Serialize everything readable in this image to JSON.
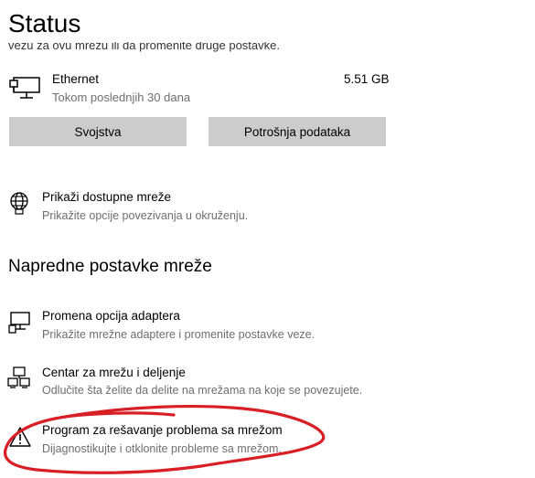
{
  "header": {
    "title": "Status"
  },
  "partial_text": "vezu za ovu mrežu ili da promenite druge postavke.",
  "network": {
    "icon": "ethernet-icon",
    "name": "Ethernet",
    "period": "Tokom poslednjih 30 dana",
    "usage": "5.51 GB"
  },
  "buttons": {
    "properties": "Svojstva",
    "data_usage": "Potrošnja podataka"
  },
  "show_networks": {
    "icon": "globe-icon",
    "title": "Prikaži dostupne mreže",
    "subtitle": "Prikažite opcije povezivanja u okruženju."
  },
  "advanced": {
    "heading": "Napredne postavke mreže",
    "items": [
      {
        "icon": "adapter-icon",
        "title": "Promena opcija adaptera",
        "subtitle": "Prikažite mrežne adaptere i promenite postavke veze."
      },
      {
        "icon": "sharing-center-icon",
        "title": "Centar za mrežu i deljenje",
        "subtitle": "Odlučite šta želite da delite na mrežama na koje se povezujete."
      },
      {
        "icon": "warning-icon",
        "title": "Program za rešavanje problema sa mrežom",
        "subtitle": "Dijagnostikujte i otklonite probleme sa mrežom."
      }
    ]
  },
  "annotation_color": "#d81f26",
  "accent_color": "#0067c0"
}
